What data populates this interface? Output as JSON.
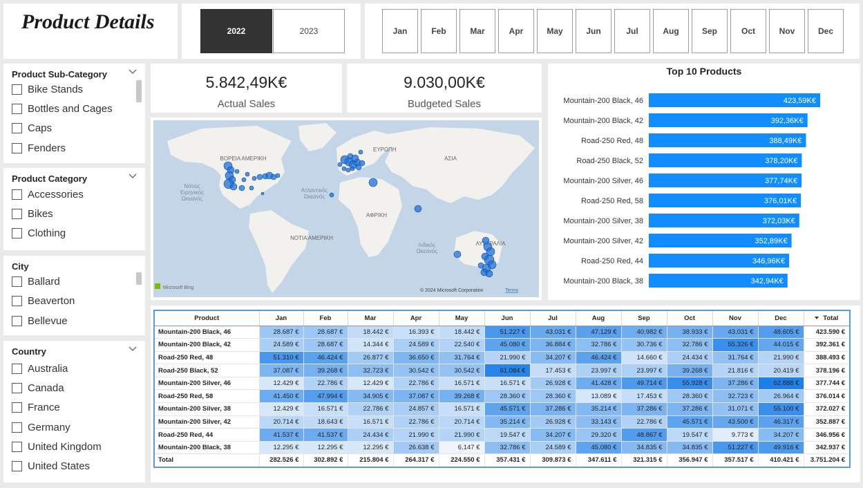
{
  "title": "Product Details",
  "years": [
    {
      "label": "2022",
      "selected": true
    },
    {
      "label": "2023",
      "selected": false
    }
  ],
  "months": [
    "Jan",
    "Feb",
    "Mar",
    "Apr",
    "May",
    "Jun",
    "Jul",
    "Aug",
    "Sep",
    "Oct",
    "Nov",
    "Dec"
  ],
  "slicers": {
    "subcategory": {
      "title": "Product Sub-Category",
      "items": [
        "Bike Stands",
        "Bottles and Cages",
        "Caps",
        "Fenders"
      ]
    },
    "category": {
      "title": "Product Category",
      "items": [
        "Accessories",
        "Bikes",
        "Clothing"
      ]
    },
    "city": {
      "title": "City",
      "items": [
        "Ballard",
        "Beaverton",
        "Bellevue"
      ]
    },
    "country": {
      "title": "Country",
      "items": [
        "Australia",
        "Canada",
        "France",
        "Germany",
        "United Kingdom",
        "United States"
      ]
    }
  },
  "kpi": {
    "actual": {
      "value": "5.842,49K€",
      "label": "Actual Sales"
    },
    "budget": {
      "value": "9.030,00K€",
      "label": "Budgeted Sales"
    }
  },
  "map": {
    "labels": {
      "north_america": "ΒΟΡΕΙΑ ΑΜΕΡΙΚΗ",
      "europe": "ΕΥΡΩΠΗ",
      "asia": "ΑΣΙΑ",
      "africa": "ΑΦΡΙΚΗ",
      "south_america": "ΝΟΤΙΑ ΑΜΕΡΙΚΗ",
      "australia": "ΑΥΣΤΡΑΛΙΑ",
      "south_pacific": "Νότιος Ειρηνικός Ωκεανός",
      "atlantic": "Ατλαντικός Ωκεανός",
      "indian": "Ινδικός Ωκεανός"
    },
    "attribution": "© 2024 Microsoft Corporation",
    "terms": "Terms",
    "bing": "Microsoft Bing",
    "colors": {
      "water": "#c4d5e8",
      "land": "#f2f1ee",
      "bubble": "#1f6fd6"
    }
  },
  "chart_data": {
    "type": "bar",
    "title": "Top 10 Products",
    "categories": [
      "Mountain-200 Black, 46",
      "Mountain-200 Black, 42",
      "Road-250 Red, 48",
      "Road-250 Black, 52",
      "Mountain-200 Silver, 46",
      "Road-250 Red, 58",
      "Mountain-200 Silver, 38",
      "Mountain-200 Silver, 42",
      "Road-250 Red, 44",
      "Mountain-200 Black, 38"
    ],
    "values": [
      423.59,
      392.36,
      388.49,
      378.2,
      377.74,
      376.01,
      372.03,
      352.89,
      346.96,
      342.94
    ],
    "data_labels": [
      "423,59K€",
      "392,36K€",
      "388,49K€",
      "378,20K€",
      "377,74K€",
      "376,01K€",
      "372,03K€",
      "352,89K€",
      "346,96K€",
      "342,94K€"
    ],
    "orientation": "horizontal",
    "xlim": [
      0,
      423.59
    ],
    "bar_color": "#118dff"
  },
  "matrix": {
    "headers": [
      "Product",
      "Jan",
      "Feb",
      "Mar",
      "Apr",
      "May",
      "Jun",
      "Jul",
      "Aug",
      "Sep",
      "Oct",
      "Nov",
      "Dec",
      "Total"
    ],
    "rows": [
      {
        "product": "Mountain-200 Black, 46",
        "months": [
          "28.687 €",
          "28.687 €",
          "18.442 €",
          "16.393 €",
          "18.442 €",
          "51.227 €",
          "43.031 €",
          "47.129 €",
          "40.982 €",
          "38.933 €",
          "43.031 €",
          "48.605 €"
        ],
        "values": [
          28687,
          28687,
          18442,
          16393,
          18442,
          51227,
          43031,
          47129,
          40982,
          38933,
          43031,
          48605
        ],
        "total": "423.590 €"
      },
      {
        "product": "Mountain-200 Black, 42",
        "months": [
          "24.589 €",
          "28.687 €",
          "14.344 €",
          "24.589 €",
          "22.540 €",
          "45.080 €",
          "36.884 €",
          "32.786 €",
          "30.736 €",
          "32.786 €",
          "55.326 €",
          "44.015 €"
        ],
        "values": [
          24589,
          28687,
          14344,
          24589,
          22540,
          45080,
          36884,
          32786,
          30736,
          32786,
          55326,
          44015
        ],
        "total": "392.361 €"
      },
      {
        "product": "Road-250 Red, 48",
        "months": [
          "51.310 €",
          "46.424 €",
          "26.877 €",
          "36.650 €",
          "31.764 €",
          "21.990 €",
          "34.207 €",
          "46.424 €",
          "14.660 €",
          "24.434 €",
          "31.764 €",
          "21.990 €"
        ],
        "values": [
          51310,
          46424,
          26877,
          36650,
          31764,
          21990,
          34207,
          46424,
          14660,
          24434,
          31764,
          21990
        ],
        "total": "388.493 €"
      },
      {
        "product": "Road-250 Black, 52",
        "months": [
          "37.087 €",
          "39.268 €",
          "32.723 €",
          "30.542 €",
          "30.542 €",
          "61.084 €",
          "17.453 €",
          "23.997 €",
          "23.997 €",
          "39.268 €",
          "21.816 €",
          "20.419 €"
        ],
        "values": [
          37087,
          39268,
          32723,
          30542,
          30542,
          61084,
          17453,
          23997,
          23997,
          39268,
          21816,
          20419
        ],
        "total": "378.196 €"
      },
      {
        "product": "Mountain-200 Silver, 46",
        "months": [
          "12.429 €",
          "22.786 €",
          "12.429 €",
          "22.786 €",
          "16.571 €",
          "16.571 €",
          "26.928 €",
          "41.428 €",
          "49.714 €",
          "55.928 €",
          "37.286 €",
          "62.888 €"
        ],
        "values": [
          12429,
          22786,
          12429,
          22786,
          16571,
          16571,
          26928,
          41428,
          49714,
          55928,
          37286,
          62888
        ],
        "total": "377.744 €"
      },
      {
        "product": "Road-250 Red, 58",
        "months": [
          "41.450 €",
          "47.994 €",
          "34.905 €",
          "37.087 €",
          "39.268 €",
          "28.360 €",
          "28.360 €",
          "13.089 €",
          "17.453 €",
          "28.360 €",
          "32.723 €",
          "26.964 €"
        ],
        "values": [
          41450,
          47994,
          34905,
          37087,
          39268,
          28360,
          28360,
          13089,
          17453,
          28360,
          32723,
          26964
        ],
        "total": "376.014 €"
      },
      {
        "product": "Mountain-200 Silver, 38",
        "months": [
          "12.429 €",
          "16.571 €",
          "22.786 €",
          "24.857 €",
          "16.571 €",
          "45.571 €",
          "37.286 €",
          "35.214 €",
          "37.286 €",
          "37.286 €",
          "31.071 €",
          "55.100 €"
        ],
        "values": [
          12429,
          16571,
          22786,
          24857,
          16571,
          45571,
          37286,
          35214,
          37286,
          37286,
          31071,
          55100
        ],
        "total": "372.027 €"
      },
      {
        "product": "Mountain-200 Silver, 42",
        "months": [
          "20.714 €",
          "18.643 €",
          "16.571 €",
          "22.786 €",
          "20.714 €",
          "35.214 €",
          "26.928 €",
          "33.143 €",
          "22.786 €",
          "45.571 €",
          "43.500 €",
          "46.317 €"
        ],
        "values": [
          20714,
          18643,
          16571,
          22786,
          20714,
          35214,
          26928,
          33143,
          22786,
          45571,
          43500,
          46317
        ],
        "total": "352.887 €"
      },
      {
        "product": "Road-250 Red, 44",
        "months": [
          "41.537 €",
          "41.537 €",
          "24.434 €",
          "21.990 €",
          "21.990 €",
          "19.547 €",
          "34.207 €",
          "29.320 €",
          "48.867 €",
          "19.547 €",
          "9.773 €",
          "34.207 €"
        ],
        "values": [
          41537,
          41537,
          24434,
          21990,
          21990,
          19547,
          34207,
          29320,
          48867,
          19547,
          9773,
          34207
        ],
        "total": "346.956 €"
      },
      {
        "product": "Mountain-200 Black, 38",
        "months": [
          "12.295 €",
          "12.295 €",
          "12.295 €",
          "26.638 €",
          "6.147 €",
          "32.786 €",
          "24.589 €",
          "45.080 €",
          "34.835 €",
          "34.835 €",
          "51.227 €",
          "49.916 €"
        ],
        "values": [
          12295,
          12295,
          12295,
          26638,
          6147,
          32786,
          24589,
          45080,
          34835,
          34835,
          51227,
          49916
        ],
        "total": "342.937 €"
      }
    ],
    "total_row": {
      "label": "Total",
      "months": [
        "282.526 €",
        "302.892 €",
        "215.804 €",
        "264.317 €",
        "224.550 €",
        "357.431 €",
        "309.873 €",
        "347.611 €",
        "321.315 €",
        "356.947 €",
        "357.517 €",
        "410.421 €"
      ],
      "total": "3.751.204 €"
    },
    "colors": {
      "low": "#eef5fd",
      "high": "#1e7fe8"
    }
  }
}
